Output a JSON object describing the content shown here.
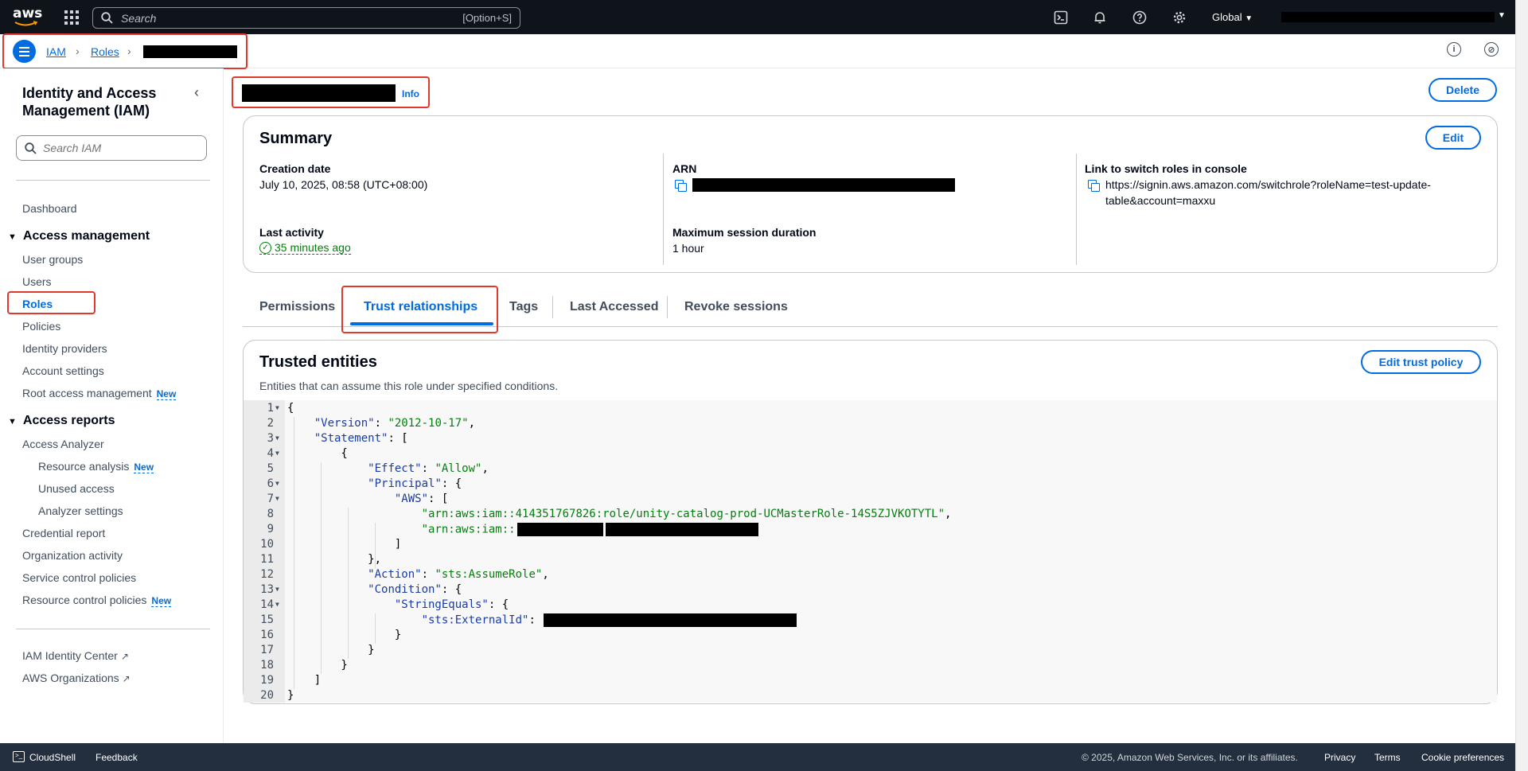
{
  "topnav": {
    "logo": "aws",
    "search_placeholder": "Search",
    "search_shortcut": "[Option+S]",
    "region": "Global"
  },
  "breadcrumb": {
    "items": [
      "IAM",
      "Roles"
    ]
  },
  "sidebar": {
    "title": "Identity and Access Management (IAM)",
    "search_placeholder": "Search IAM",
    "dashboard": "Dashboard",
    "access_management": {
      "label": "Access management",
      "items": [
        "User groups",
        "Users",
        "Roles",
        "Policies",
        "Identity providers",
        "Account settings",
        "Root access management"
      ]
    },
    "access_reports": {
      "label": "Access reports",
      "items": [
        "Access Analyzer",
        "Resource analysis",
        "Unused access",
        "Analyzer settings",
        "Credential report",
        "Organization activity",
        "Service control policies",
        "Resource control policies"
      ]
    },
    "new_badge": "New",
    "external": [
      "IAM Identity Center",
      "AWS Organizations"
    ]
  },
  "header": {
    "info": "Info",
    "delete": "Delete"
  },
  "summary": {
    "title": "Summary",
    "edit": "Edit",
    "creation_date_label": "Creation date",
    "creation_date": "July 10, 2025, 08:58 (UTC+08:00)",
    "arn_label": "ARN",
    "link_label": "Link to switch roles in console",
    "link_line1": "https://signin.aws.amazon.com/switchrole?roleName=test-update-",
    "link_line2": "table&account=maxxu",
    "last_activity_label": "Last activity",
    "last_activity": "35 minutes ago",
    "max_session_label": "Maximum session duration",
    "max_session": "1 hour"
  },
  "tabs": [
    "Permissions",
    "Trust relationships",
    "Tags",
    "Last Accessed",
    "Revoke sessions"
  ],
  "trusted": {
    "title": "Trusted entities",
    "description": "Entities that can assume this role under specified conditions.",
    "edit": "Edit trust policy",
    "lines": [
      "{",
      "    \"Version\": \"2012-10-17\",",
      "    \"Statement\": [",
      "        {",
      "            \"Effect\": \"Allow\",",
      "            \"Principal\": {",
      "                \"AWS\": [",
      "                    \"arn:aws:iam::414351767826:role/unity-catalog-prod-UCMasterRole-14S5ZJVKOTYTL\",",
      "                    \"arn:aws:iam::",
      "                ]",
      "            },",
      "            \"Action\": \"sts:AssumeRole\",",
      "            \"Condition\": {",
      "                \"StringEquals\": {",
      "                    \"sts:ExternalId\": ",
      "                }",
      "            }",
      "        }",
      "    ]",
      "}"
    ]
  },
  "footer": {
    "cloudshell": "CloudShell",
    "feedback": "Feedback",
    "copyright": "© 2025, Amazon Web Services, Inc. or its affiliates.",
    "privacy": "Privacy",
    "terms": "Terms",
    "cookies": "Cookie preferences"
  }
}
